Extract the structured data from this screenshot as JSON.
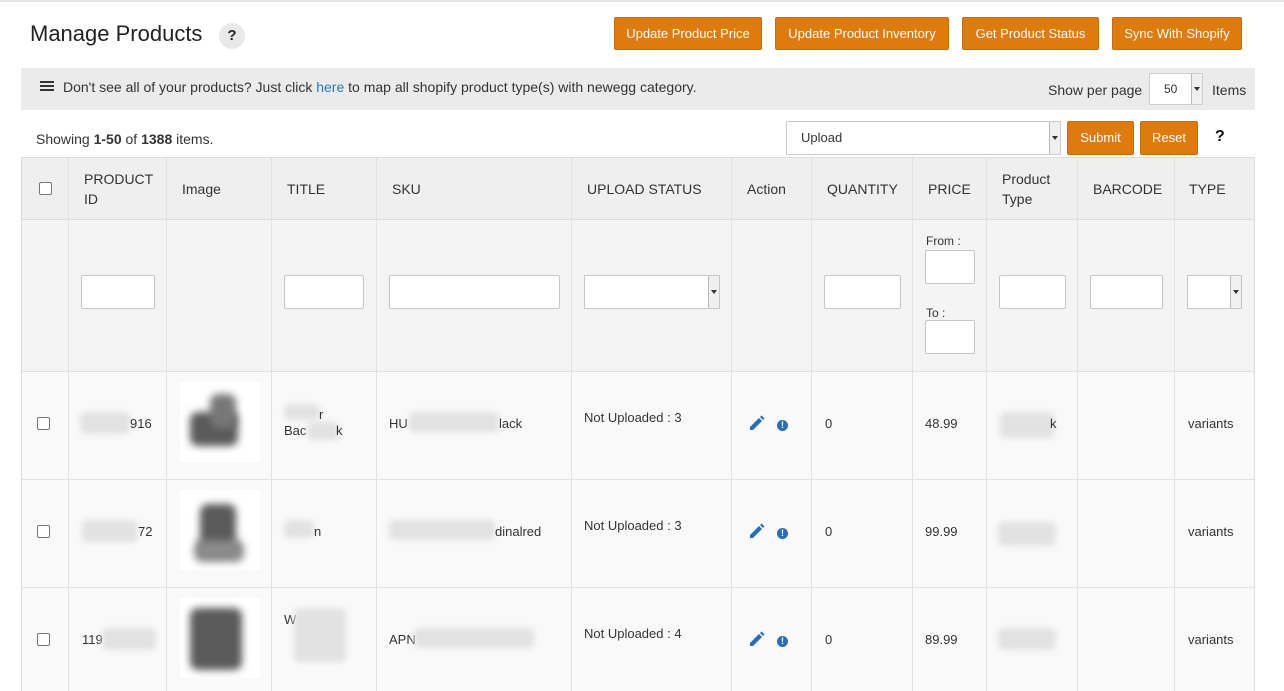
{
  "header": {
    "title": "Manage Products",
    "help": "?",
    "buttons": {
      "update_price": "Update Product Price",
      "update_inventory": "Update Product Inventory",
      "get_status": "Get Product Status",
      "sync": "Sync With Shopify"
    }
  },
  "notice": {
    "prefix": "Don't see all of your products? Just click ",
    "link": "here",
    "suffix": " to map all shopify product type(s) with newegg category.",
    "per_page_label": "Show per page",
    "per_page_value": "50",
    "items_label": "Items"
  },
  "toolbar": {
    "showing_prefix": "Showing ",
    "showing_range": "1-50",
    "showing_mid": " of ",
    "showing_total": "1388",
    "showing_suffix": " items.",
    "bulk_action": "Upload",
    "submit": "Submit",
    "reset": "Reset",
    "help": "?"
  },
  "columns": {
    "product_id_1": "PRODUCT",
    "product_id_2": "ID",
    "image": "Image",
    "title": "TITLE",
    "sku": "SKU",
    "upload_status": "UPLOAD STATUS",
    "action": "Action",
    "quantity": "QUANTITY",
    "price": "PRICE",
    "product_type_1": "Product",
    "product_type_2": "Type",
    "barcode": "BARCODE",
    "type": "TYPE"
  },
  "filters": {
    "price_from": "From :",
    "price_to": "To :"
  },
  "rows": [
    {
      "product_id": "916",
      "title_line1": "r",
      "title_line2": "Bac",
      "title_line2_end": "k",
      "sku_start": "HU",
      "sku_end": "lack",
      "upload_status": "Not Uploaded : 3",
      "quantity": "0",
      "price": "48.99",
      "product_type": "k",
      "type": "variants"
    },
    {
      "product_id": "72",
      "title_line1": "n",
      "title_line2": "",
      "title_line2_end": "",
      "sku_start": "",
      "sku_end": "dinalred",
      "upload_status": "Not Uploaded : 3",
      "quantity": "0",
      "price": "99.99",
      "product_type": "",
      "type": "variants"
    },
    {
      "product_id": "119",
      "title_line1": "W",
      "title_line2": "",
      "title_line2_end": "",
      "sku_start": "APN",
      "sku_end": "",
      "upload_status": "Not Uploaded : 4",
      "quantity": "0",
      "price": "89.99",
      "product_type": "",
      "type": "variants"
    }
  ],
  "colors": {
    "accent": "#de7b0e",
    "link": "#2a7ab9",
    "icon_blue": "#2a6db5"
  },
  "icons": [
    "list-icon",
    "edit-icon",
    "info-icon",
    "chevron-down-icon"
  ]
}
